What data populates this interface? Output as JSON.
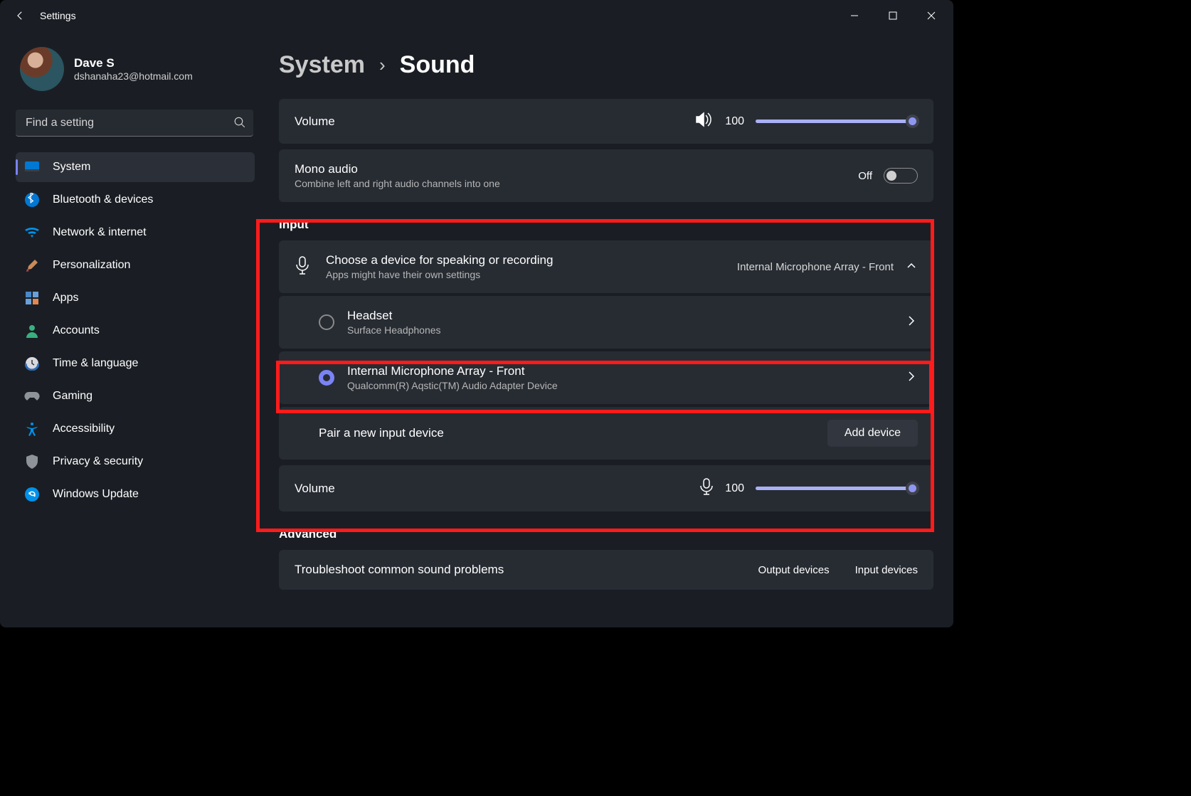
{
  "window": {
    "title": "Settings"
  },
  "user": {
    "name": "Dave S",
    "email": "dshanaha23@hotmail.com"
  },
  "search": {
    "placeholder": "Find a setting"
  },
  "nav": {
    "items": [
      {
        "label": "System"
      },
      {
        "label": "Bluetooth & devices"
      },
      {
        "label": "Network & internet"
      },
      {
        "label": "Personalization"
      },
      {
        "label": "Apps"
      },
      {
        "label": "Accounts"
      },
      {
        "label": "Time & language"
      },
      {
        "label": "Gaming"
      },
      {
        "label": "Accessibility"
      },
      {
        "label": "Privacy & security"
      },
      {
        "label": "Windows Update"
      }
    ]
  },
  "breadcrumb": {
    "parent": "System",
    "current": "Sound"
  },
  "output": {
    "volume_label": "Volume",
    "volume_value": "100",
    "mono_title": "Mono audio",
    "mono_sub": "Combine left and right audio channels into one",
    "mono_state": "Off"
  },
  "input": {
    "section": "Input",
    "choose_title": "Choose a device for speaking or recording",
    "choose_sub": "Apps might have their own settings",
    "choose_selected": "Internal Microphone Array - Front",
    "dev1_title": "Headset",
    "dev1_sub": "Surface Headphones",
    "dev2_title": "Internal Microphone Array - Front",
    "dev2_sub": "Qualcomm(R) Aqstic(TM) Audio Adapter Device",
    "pair_label": "Pair a new input device",
    "add_button": "Add device",
    "volume_label": "Volume",
    "volume_value": "100"
  },
  "advanced": {
    "section": "Advanced",
    "troubleshoot": "Troubleshoot common sound problems",
    "out_link": "Output devices",
    "in_link": "Input devices"
  }
}
